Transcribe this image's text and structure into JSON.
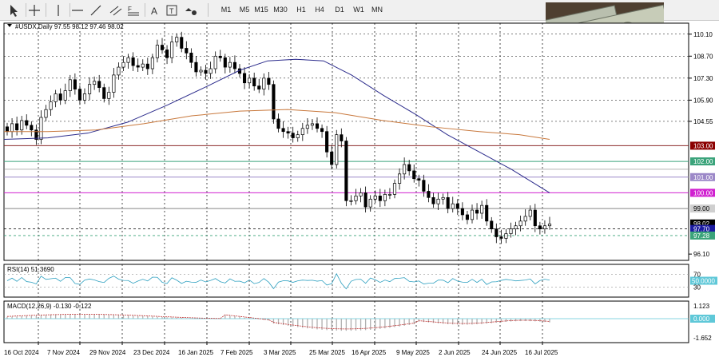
{
  "toolbar": {
    "tools": [
      {
        "name": "cursor-icon"
      },
      {
        "name": "crosshair-icon"
      },
      {
        "name": "vertical-line-icon"
      },
      {
        "name": "horizontal-line-icon"
      },
      {
        "name": "trendline-icon"
      },
      {
        "name": "channel-icon"
      },
      {
        "name": "fibonacci-icon"
      },
      {
        "name": "text-icon"
      },
      {
        "name": "label-icon"
      },
      {
        "name": "shapes-icon"
      }
    ],
    "timeframes": [
      "M1",
      "M5",
      "M15",
      "M30",
      "H1",
      "H4",
      "D1",
      "W1",
      "MN"
    ]
  },
  "chart": {
    "header": "#USDX,Daily  97.55 98.12 97.46 98.02",
    "price_ticks": [
      "110.10",
      "108.70",
      "107.30",
      "105.90",
      "104.55",
      "96.10"
    ],
    "price_tags": [
      {
        "label": "103.00",
        "bg": "#8b0000",
        "fg": "#ffffff",
        "price": 103.0
      },
      {
        "label": "102.00",
        "bg": "#3aa37a",
        "fg": "#ffffff",
        "price": 102.0
      },
      {
        "label": "101.00",
        "bg": "#9c88c8",
        "fg": "#ffffff",
        "price": 101.0
      },
      {
        "label": "100.00",
        "bg": "#d020d0",
        "fg": "#ffffff",
        "price": 100.0
      },
      {
        "label": "99.00",
        "bg": "#cfcfcf",
        "fg": "#000000",
        "price": 99.0
      },
      {
        "label": "98.02",
        "bg": "#000000",
        "fg": "#ffffff",
        "price": 98.05
      },
      {
        "label": "97.70",
        "bg": "#1a1aa0",
        "fg": "#ffffff",
        "price": 97.7
      },
      {
        "label": "97.28",
        "bg": "#3aa37a",
        "fg": "#ffffff",
        "price": 97.28
      }
    ],
    "date_labels": [
      "16 Oct 2024",
      "7 Nov 2024",
      "29 Nov 2024",
      "23 Dec 2024",
      "16 Jan 2025",
      "7 Feb 2025",
      "3 Mar 2025",
      "25 Mar 2025",
      "16 Apr 2025",
      "9 May 2025",
      "2 Jun 2025",
      "24 Jun 2025",
      "16 Jul 2025"
    ],
    "colors": {
      "grid": "#000000",
      "ma_fast": "#2c2c8c",
      "ma_slow": "#c8783c",
      "level_red": "#8b2a2a",
      "level_green": "#3aa37a",
      "level_purple": "#9c88c8",
      "level_magenta": "#d020d0",
      "level_gray": "#888888"
    }
  },
  "rsi": {
    "header": "RSI(14) 51.3690",
    "ticks": [
      "70",
      "30"
    ],
    "value_tag": "50.0000",
    "value_tag_bg": "#5fc8d8"
  },
  "macd": {
    "header": "MACD(12,26,9) -0.130 -0.122",
    "ticks": [
      "1.123",
      "-1.652"
    ],
    "value_tag": "0.000",
    "value_tag_bg": "#5fc8d8"
  },
  "close_series": [
    103.9,
    104.4,
    104.0,
    104.6,
    104.3,
    104.0,
    103.4,
    104.8,
    105.3,
    105.8,
    106.3,
    105.9,
    106.5,
    107.2,
    106.6,
    105.9,
    106.3,
    106.9,
    107.1,
    106.7,
    106.0,
    106.4,
    107.5,
    108.0,
    108.3,
    108.6,
    108.1,
    108.0,
    108.2,
    107.9,
    108.6,
    109.4,
    109.1,
    108.6,
    109.6,
    109.9,
    109.2,
    108.9,
    108.3,
    107.7,
    107.8,
    107.6,
    107.9,
    108.7,
    108.6,
    108.0,
    108.3,
    107.9,
    107.6,
    107.0,
    107.3,
    106.8,
    106.6,
    107.3,
    106.9,
    104.7,
    104.1,
    103.9,
    103.8,
    103.5,
    103.7,
    104.1,
    104.3,
    104.4,
    104.1,
    103.9,
    102.6,
    101.8,
    103.7,
    103.3,
    99.5,
    99.5,
    99.8,
    100.0,
    99.1,
    99.6,
    99.8,
    99.5,
    99.9,
    99.9,
    100.6,
    101.2,
    101.8,
    101.4,
    100.9,
    100.8,
    100.1,
    99.7,
    99.3,
    99.6,
    99.7,
    99.0,
    99.3,
    99.0,
    98.6,
    98.3,
    98.9,
    98.7,
    99.2,
    98.2,
    97.7,
    97.2,
    97.1,
    97.4,
    97.7,
    97.9,
    98.2,
    98.5,
    98.9,
    97.9,
    97.7,
    97.9,
    98.02
  ]
}
